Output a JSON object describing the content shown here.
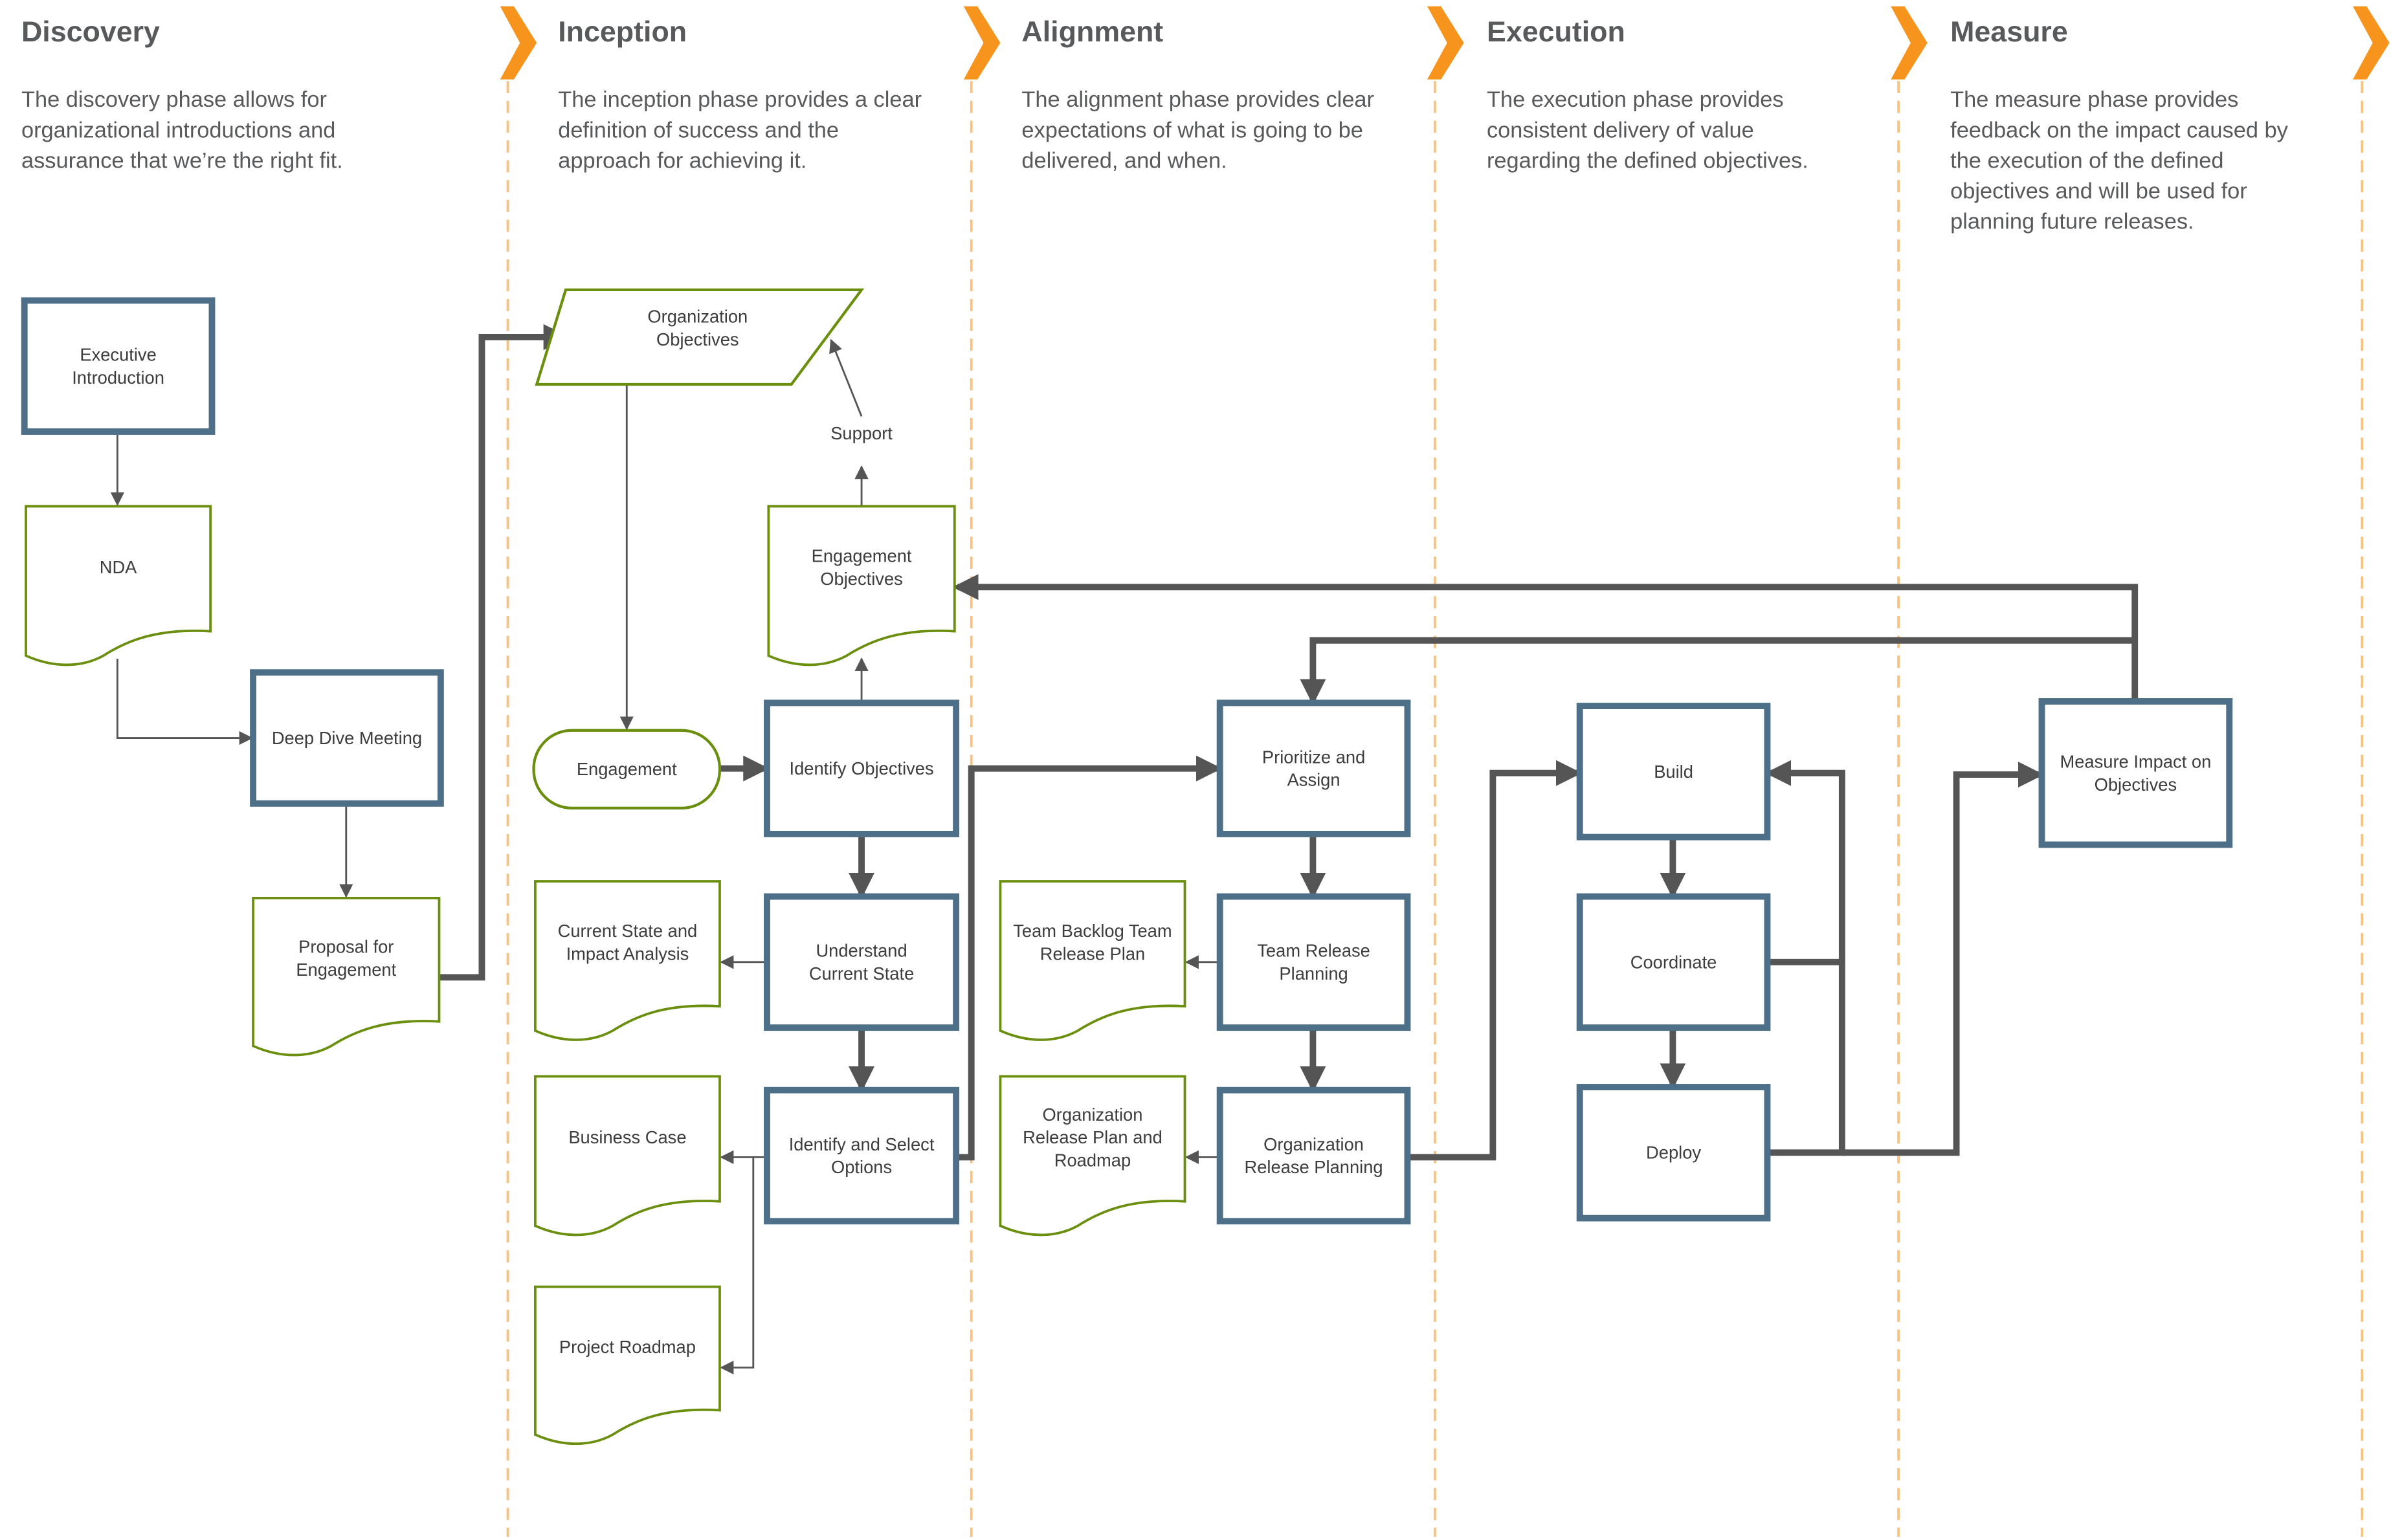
{
  "colors": {
    "accent_orange": "#f7941d",
    "process_blue": "#4d7088",
    "document_green": "#6a8e0e",
    "connector_gray": "#555555"
  },
  "phases": [
    {
      "title": "Discovery",
      "description": [
        "The discovery phase allows for",
        "organizational introductions and",
        "assurance that we’re the right fit."
      ]
    },
    {
      "title": "Inception",
      "description": [
        "The inception phase provides a clear",
        "definition of success and the",
        "approach for achieving it."
      ]
    },
    {
      "title": "Alignment",
      "description": [
        "The alignment phase provides clear",
        "expectations of what is going to be",
        "delivered, and when."
      ]
    },
    {
      "title": "Execution",
      "description": [
        "The execution phase provides",
        "consistent delivery of value",
        "regarding the defined objectives."
      ]
    },
    {
      "title": "Measure",
      "description": [
        "The measure phase provides",
        "feedback on the impact caused by",
        "the execution of the defined",
        "objectives and will be used for",
        "planning future releases."
      ]
    }
  ],
  "nodes": {
    "exec_intro": {
      "type": "process",
      "label": [
        "Executive",
        "Introduction"
      ]
    },
    "nda": {
      "type": "document",
      "label": [
        "NDA"
      ]
    },
    "deep_dive": {
      "type": "process",
      "label": [
        "Deep Dive Meeting"
      ]
    },
    "proposal": {
      "type": "document",
      "label": [
        "Proposal for",
        "Engagement"
      ]
    },
    "org_objectives": {
      "type": "data",
      "label": [
        "Organization",
        "Objectives"
      ]
    },
    "engagement": {
      "type": "terminator",
      "label": [
        "Engagement"
      ]
    },
    "engagement_objectives": {
      "type": "document",
      "label": [
        "Engagement",
        "Objectives"
      ]
    },
    "identify_objectives": {
      "type": "process",
      "label": [
        "Identify Objectives"
      ]
    },
    "understand_state": {
      "type": "process",
      "label": [
        "Understand",
        "Current State"
      ]
    },
    "identify_options": {
      "type": "process",
      "label": [
        "Identify and Select",
        "Options"
      ]
    },
    "current_state_doc": {
      "type": "document",
      "label": [
        "Current State and",
        "Impact Analysis"
      ]
    },
    "business_case": {
      "type": "document",
      "label": [
        "Business Case"
      ]
    },
    "project_roadmap": {
      "type": "document",
      "label": [
        "Project Roadmap"
      ]
    },
    "prioritize": {
      "type": "process",
      "label": [
        "Prioritize and",
        "Assign"
      ]
    },
    "team_release_planning": {
      "type": "process",
      "label": [
        "Team Release",
        "Planning"
      ]
    },
    "org_release_planning": {
      "type": "process",
      "label": [
        "Organization",
        "Release Planning"
      ]
    },
    "team_backlog_doc": {
      "type": "document",
      "label": [
        "Team Backlog Team",
        "Release Plan"
      ]
    },
    "org_release_doc": {
      "type": "document",
      "label": [
        "Organization",
        "Release Plan and",
        "Roadmap"
      ]
    },
    "build": {
      "type": "process",
      "label": [
        "Build"
      ]
    },
    "coordinate": {
      "type": "process",
      "label": [
        "Coordinate"
      ]
    },
    "deploy": {
      "type": "process",
      "label": [
        "Deploy"
      ]
    },
    "measure_impact": {
      "type": "process",
      "label": [
        "Measure Impact on",
        "Objectives"
      ]
    }
  },
  "connector_labels": {
    "support": "Support"
  }
}
